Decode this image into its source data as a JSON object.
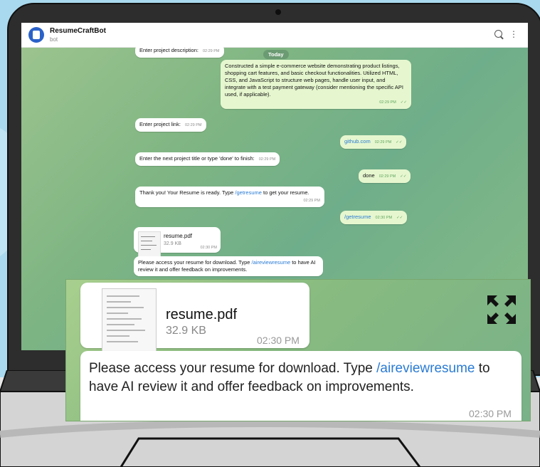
{
  "app": {
    "name": "ResumeCraftBot",
    "subtitle": "bot"
  },
  "day_label": "Today",
  "messages": {
    "m1": {
      "text": "Enter project description:",
      "time": "02:29 PM"
    },
    "m2": {
      "text": "Constructed a simple e-commerce website demonstrating product listings, shopping cart features, and basic checkout functionalities. Utilized HTML, CSS, and JavaScript to structure web pages, handle user input, and integrate with a test payment gateway (consider mentioning the specific API used, if applicable).",
      "time": "02:29 PM"
    },
    "m3": {
      "text": "Enter project link:",
      "time": "02:29 PM"
    },
    "m4": {
      "text": "github.com",
      "time": "02:29 PM"
    },
    "m5": {
      "text": "Enter the next project title or type 'done' to finish:",
      "time": "02:29 PM"
    },
    "m6": {
      "text": "done",
      "time": "02:29 PM"
    },
    "m7": {
      "text_a": "Thank you! Your Resume is ready. Type ",
      "cmd": "/getresume",
      "text_b": " to get your resume.",
      "time": "02:29 PM"
    },
    "m8": {
      "text": "/getresume",
      "time": "02:30 PM"
    },
    "file": {
      "name": "resume.pdf",
      "size": "32.9 KB",
      "time": "02:30 PM"
    },
    "m9": {
      "text_a": "Please access your resume for download. Type ",
      "cmd": "/aireviewresume",
      "text_b": " to have AI review it and offer feedback on improvements.",
      "time": "02:30 PM"
    }
  },
  "colors": {
    "link": "#2a7bd4",
    "outgoing": "#e6f7cf",
    "header_avatar": "#2b62c9"
  },
  "icons": [
    "search-icon",
    "kebab-menu-icon",
    "fullscreen-icon",
    "read-check-icon"
  ]
}
